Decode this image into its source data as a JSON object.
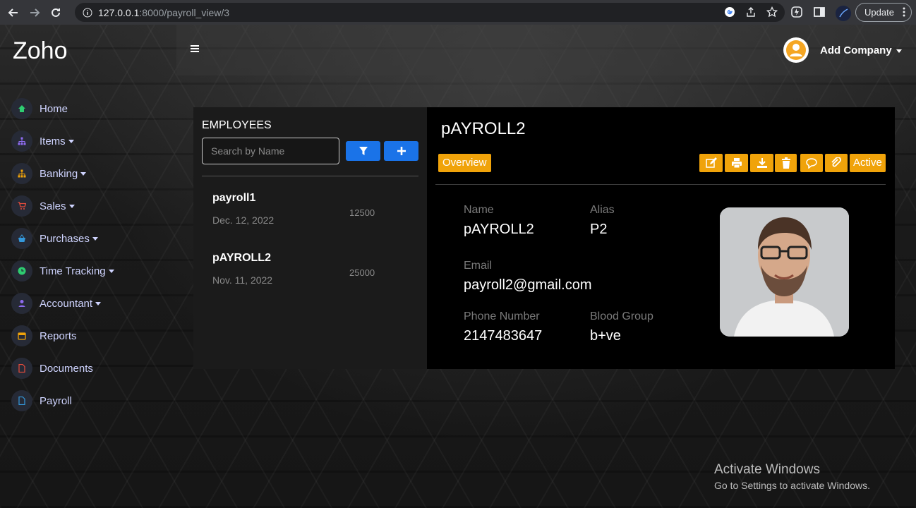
{
  "browser": {
    "url_host": "127.0.0.1",
    "url_rest": ":8000/payroll_view/3",
    "update_label": "Update"
  },
  "brand": "Zoho",
  "header": {
    "company_label": "Add Company"
  },
  "sidebar": {
    "items": [
      {
        "label": "Home",
        "icon": "home-icon",
        "color": "#2ecc71",
        "dropdown": false
      },
      {
        "label": "Items",
        "icon": "hierarchy-icon",
        "color": "#8e6cf0",
        "dropdown": true
      },
      {
        "label": "Banking",
        "icon": "hierarchy-icon",
        "color": "#f0a30a",
        "dropdown": true
      },
      {
        "label": "Sales",
        "icon": "cart-icon",
        "color": "#e74c3c",
        "dropdown": true
      },
      {
        "label": "Purchases",
        "icon": "basket-icon",
        "color": "#3498db",
        "dropdown": true
      },
      {
        "label": "Time Tracking",
        "icon": "clock-icon",
        "color": "#2ecc71",
        "dropdown": true
      },
      {
        "label": "Accountant",
        "icon": "user-icon",
        "color": "#8e6cf0",
        "dropdown": true
      },
      {
        "label": "Reports",
        "icon": "calendar-icon",
        "color": "#f0a30a",
        "dropdown": false
      },
      {
        "label": "Documents",
        "icon": "document-icon",
        "color": "#e74c3c",
        "dropdown": false
      },
      {
        "label": "Payroll",
        "icon": "document-icon",
        "color": "#3498db",
        "dropdown": false
      }
    ]
  },
  "employees": {
    "title": "EMPLOYEES",
    "search_placeholder": "Search by Name",
    "rows": [
      {
        "name": "payroll1",
        "date": "Dec. 12, 2022",
        "amount": "12500"
      },
      {
        "name": "pAYROLL2",
        "date": "Nov. 11, 2022",
        "amount": "25000"
      }
    ]
  },
  "detail": {
    "title": "pAYROLL2",
    "overview_label": "Overview",
    "active_label": "Active",
    "accent": "#f0a30a",
    "fields": {
      "name_label": "Name",
      "name_value": "pAYROLL2",
      "alias_label": "Alias",
      "alias_value": "P2",
      "email_label": "Email",
      "email_value": "payroll2@gmail.com",
      "phone_label": "Phone Number",
      "phone_value": "2147483647",
      "blood_label": "Blood Group",
      "blood_value": "b+ve"
    }
  },
  "watermark": {
    "line1": "Activate Windows",
    "line2": "Go to Settings to activate Windows."
  }
}
